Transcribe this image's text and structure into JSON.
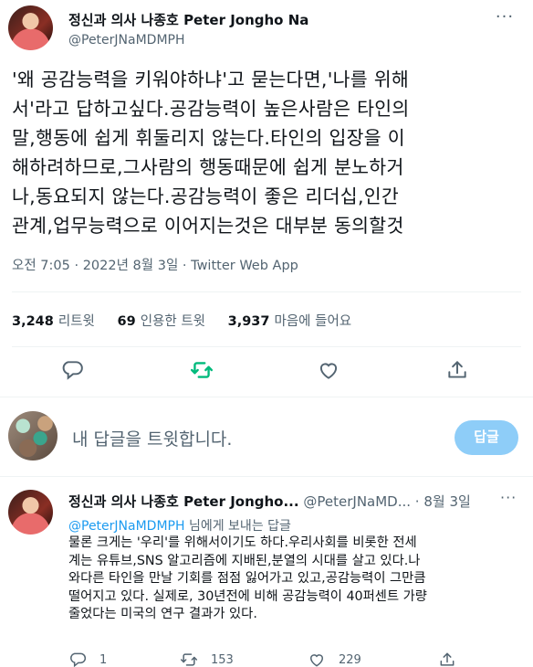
{
  "tweet": {
    "display_name": "정신과 의사 나종호 Peter Jongho Na",
    "handle": "@PeterJNaMDMPH",
    "text_lines": [
      "'왜 공감능력을 키워야하냐'고 묻는다면,'나를 위해",
      "서'라고 답하고싶다.공감능력이 높은사람은 타인의",
      "말,행동에 쉽게 휘둘리지 않는다.타인의 입장을 이",
      "해하려하므로,그사람의 행동때문에 쉽게 분노하거",
      "나,동요되지 않는다.공감능력이 좋은 리더십,인간",
      "관계,업무능력으로 이어지는것은 대부분 동의할것"
    ],
    "time": "오전 7:05",
    "date": "2022년 8월 3일",
    "source": "Twitter Web App",
    "separator": " · ",
    "stats": {
      "retweets_count": "3,248",
      "retweets_label": "리트윗",
      "quotes_count": "69",
      "quotes_label": "인용한 트윗",
      "likes_count": "3,937",
      "likes_label": "마음에 들어요"
    },
    "icons": {
      "more": "more-icon",
      "reply": "reply-icon",
      "retweet": "retweet-icon",
      "like": "like-icon",
      "share": "share-icon"
    },
    "colors": {
      "retweet_active": "#00ba7c",
      "reply_button": "#8ecdf8",
      "mention": "#1d9bf0"
    }
  },
  "reply_box": {
    "placeholder": "내 답글을 트윗합니다.",
    "button_label": "답글"
  },
  "reply_tweet": {
    "display_name": "정신과 의사 나종호 Peter Jongho...",
    "handle": "@PeterJNaMD...",
    "separator": " · ",
    "date": "8월 3일",
    "reply_to_mention": "@PeterJNaMDMPH",
    "reply_to_suffix": " 님에게 보내는 답글",
    "text_lines": [
      "물론 크게는 '우리'를 위해서이기도 하다.우리사회를 비롯한 전세",
      "계는 유튜브,SNS 알고리즘에 지배된,분열의 시대를 살고 있다.나",
      "와다른 타인을 만날 기회를 점점 잃어가고 있고,공감능력이 그만큼",
      "떨어지고 있다. 실제로, 30년전에 비해 공감능력이 40퍼센트 가량",
      "줄었다는 미국의 연구 결과가 있다."
    ],
    "reply_count": "1",
    "retweet_count": "153",
    "like_count": "229"
  }
}
